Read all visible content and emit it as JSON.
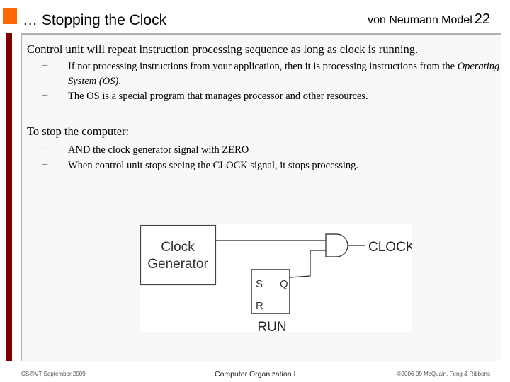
{
  "header": {
    "title": "… Stopping the Clock",
    "section": "von Neumann Model",
    "slide_number": "22"
  },
  "colors": {
    "accent_orange": "#ff6600",
    "accent_dark_red": "#7a0000",
    "panel_background": "#f8f8f8",
    "panel_border": "#b0b0b0"
  },
  "content": {
    "blocks": [
      {
        "heading": "Control unit will repeat instruction processing sequence as long as clock is running.",
        "bullets": [
          {
            "text_before": "If not processing instructions from your application, then it is processing instructions from the ",
            "text_italic": "Operating System (OS)",
            "text_after": "."
          },
          {
            "text_before": "The OS is a special program that manages processor and other resources.",
            "text_italic": "",
            "text_after": ""
          }
        ]
      },
      {
        "heading": "To stop the computer:",
        "bullets": [
          {
            "text_before": "AND the clock generator signal with ZERO",
            "text_italic": "",
            "text_after": ""
          },
          {
            "text_before": "When control unit stops seeing the CLOCK signal, it stops processing.",
            "text_italic": "",
            "text_after": ""
          }
        ]
      }
    ],
    "bullet_glyph": "–"
  },
  "diagram": {
    "clock_generator_line1": "Clock",
    "clock_generator_line2": "Generator",
    "flipflop_s": "S",
    "flipflop_q": "Q",
    "flipflop_r": "R",
    "flipflop_label": "RUN",
    "output_label": "CLOCK",
    "gate_type": "AND"
  },
  "footer": {
    "left": "CS@VT September 2009",
    "center": "Computer Organization I",
    "right": "©2006-09 McQuain, Feng & Ribbens"
  }
}
